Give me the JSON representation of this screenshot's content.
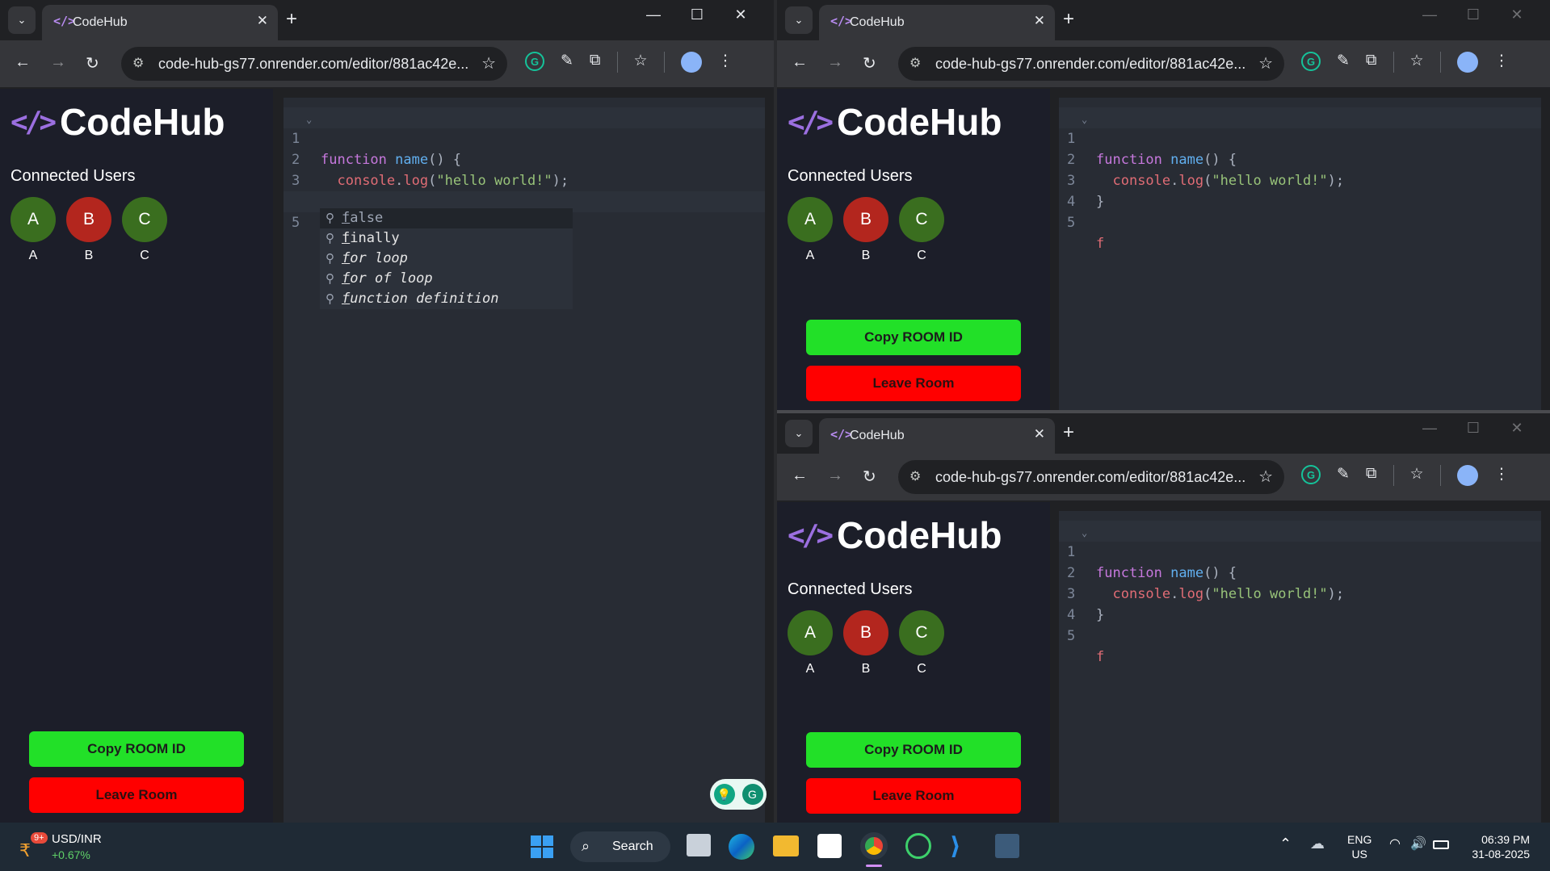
{
  "browser": {
    "tab_title": "CodeHub",
    "favicon": "</>",
    "url": "code-hub-gs77.onrender.com/editor/881ac42e...",
    "tab_close": "✕",
    "new_tab": "+",
    "dropdown": "⌄"
  },
  "app": {
    "logo_mark": "</>",
    "logo_text": "CodeHub",
    "connected_users_label": "Connected Users",
    "users": [
      {
        "initial": "A",
        "name": "A",
        "color": "#3a6e1f"
      },
      {
        "initial": "B",
        "name": "B",
        "color": "#b3261e"
      },
      {
        "initial": "C",
        "name": "C",
        "color": "#3a6e1f"
      }
    ],
    "copy_button": "Copy ROOM ID",
    "leave_button": "Leave Room"
  },
  "editor": {
    "line_numbers": [
      "1",
      "2",
      "3",
      "4",
      "5"
    ],
    "line1": {
      "kw": "function",
      "fn": "name",
      "rest": "() {"
    },
    "line2": {
      "indent": "  ",
      "obj": "console",
      "dot": ".",
      "method": "log",
      "open": "(",
      "str": "\"hello world!\"",
      "close": ");"
    },
    "line3": "}",
    "line5": "f",
    "autocomplete": [
      {
        "match": "f",
        "rest": "alse"
      },
      {
        "match": "f",
        "rest": "inally"
      },
      {
        "match": "f",
        "rest": "or loop"
      },
      {
        "match": "f",
        "rest": "or of loop"
      },
      {
        "match": "f",
        "rest": "unction definition"
      }
    ]
  },
  "taskbar": {
    "widget_badge": "9+",
    "widget_title": "USD/INR",
    "widget_value": "+0.67%",
    "search_label": "Search",
    "lang_top": "ENG",
    "lang_bottom": "US",
    "time": "06:39 PM",
    "date": "31-08-2025"
  },
  "colors": {
    "accent_green": "#22e028",
    "accent_red": "#ff0000",
    "editor_bg": "#282c34",
    "sidebar_bg": "#1c1e29"
  }
}
